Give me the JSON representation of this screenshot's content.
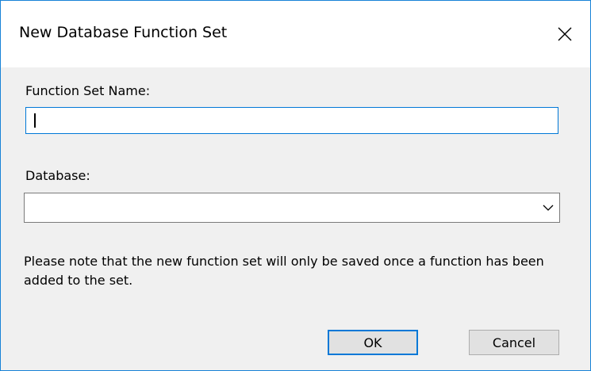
{
  "dialog": {
    "title": "New Database Function Set",
    "close_icon": "close-icon"
  },
  "form": {
    "name_label": "Function Set Name:",
    "name_value": "",
    "database_label": "Database:",
    "database_selected": "",
    "dropdown_icon": "chevron-down-icon"
  },
  "note": {
    "text": "Please note that the new function set will only be saved once a function has been added to the set."
  },
  "buttons": {
    "ok_label": "OK",
    "cancel_label": "Cancel"
  },
  "colors": {
    "accent": "#0078d7",
    "window_border": "#1883d7",
    "background": "#f0f0f0",
    "button_face": "#e1e1e1"
  }
}
